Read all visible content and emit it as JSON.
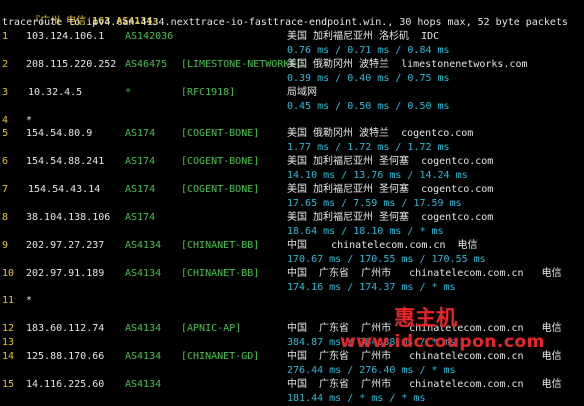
{
  "header": {
    "open": "『",
    "region": "广州 电信",
    "num": "163",
    "asn": "AS4134",
    "close": "』"
  },
  "command": "traceroute to ipv4.can-4134.nexttrace-io-fasttrace-endpoint.win., 30 hops max, 52 byte packets",
  "hops": [
    {
      "n": "1",
      "ip": "103.124.106.1",
      "as": "AS142036",
      "tag": "",
      "geo": "美国 加利福尼亚州 洛杉矶  IDC",
      "rtt": "0.76 ms / 0.71 ms / 0.84 ms"
    },
    {
      "n": "2",
      "ip": "208.115.220.252",
      "as": "AS46475",
      "tag": "[LIMESTONE-NETWORKS]",
      "geo": "美国 俄勒冈州 波特兰  limestonenetworks.com",
      "rtt": "0.39 ms / 0.40 ms / 0.75 ms"
    },
    {
      "n": "3",
      "ip": "10.32.4.5",
      "as": "*",
      "tag": "[RFC1918]",
      "geo": "局域网",
      "rtt": "0.45 ms / 0.50 ms / 0.50 ms"
    },
    {
      "n": "4",
      "ip": "*",
      "as": "",
      "tag": "",
      "geo": "",
      "rtt": ""
    },
    {
      "n": "5",
      "ip": "154.54.80.9",
      "as": "AS174",
      "tag": "[COGENT-BONE]",
      "geo": "美国 俄勒冈州 波特兰  cogentco.com",
      "rtt": "1.77 ms / 1.72 ms / 1.72 ms"
    },
    {
      "n": "6",
      "ip": "154.54.88.241",
      "as": "AS174",
      "tag": "[COGENT-BONE]",
      "geo": "美国 加利福尼亚州 圣何塞  cogentco.com",
      "rtt": "14.10 ms / 13.76 ms / 14.24 ms"
    },
    {
      "n": "7",
      "ip": "154.54.43.14",
      "as": "AS174",
      "tag": "[COGENT-BONE]",
      "geo": "美国 加利福尼亚州 圣何塞  cogentco.com",
      "rtt": "17.65 ms / 7.59 ms / 17.59 ms"
    },
    {
      "n": "8",
      "ip": "38.104.138.106",
      "as": "AS174",
      "tag": "",
      "geo": "美国 加利福尼亚州 圣何塞  cogentco.com",
      "rtt": "18.64 ms / 18.10 ms / * ms"
    },
    {
      "n": "9",
      "ip": "202.97.27.237",
      "as": "AS4134",
      "tag": "[CHINANET-BB]",
      "geo": "中国    chinatelecom.com.cn  电信",
      "rtt": "170.67 ms / 170.55 ms / 170.55 ms"
    },
    {
      "n": "10",
      "ip": "202.97.91.189",
      "as": "AS4134",
      "tag": "[CHINANET-BB]",
      "geo": "中国  广东省  广州市   chinatelecom.com.cn   电信",
      "rtt": "174.16 ms / 174.37 ms / * ms"
    },
    {
      "n": "11",
      "ip": "*",
      "as": "",
      "tag": "",
      "geo": "",
      "rtt": ""
    },
    {
      "n": "12",
      "ip": "183.60.112.74",
      "as": "AS4134",
      "tag": "[APNIC-AP]",
      "geo": "中国  广东省  广州市   chinatelecom.com.cn   电信",
      "rtt": "384.87 ms / 384.88 ms / * ms"
    },
    {
      "n": "13",
      "ip": "",
      "as": "",
      "tag": "",
      "geo": "",
      "rtt": ""
    },
    {
      "n": "14",
      "ip": "125.88.170.66",
      "as": "AS4134",
      "tag": "[CHINANET-GD]",
      "geo": "中国  广东省  广州市   chinatelecom.com.cn   电信",
      "rtt": "276.44 ms / 276.40 ms / * ms"
    },
    {
      "n": "15",
      "ip": "14.116.225.60",
      "as": "AS4134",
      "tag": "",
      "geo": "中国  广东省  广州市   chinatelecom.com.cn   电信",
      "rtt": "181.44 ms / * ms / * ms"
    }
  ],
  "watermark": {
    "title": "惠主机",
    "url": "www.idccoupon.com"
  },
  "colors": {
    "background": "#000000",
    "yellow": "#e5c52a",
    "green": "#47c24a",
    "cyan": "#2fb8d6",
    "red": "#e8262a"
  }
}
